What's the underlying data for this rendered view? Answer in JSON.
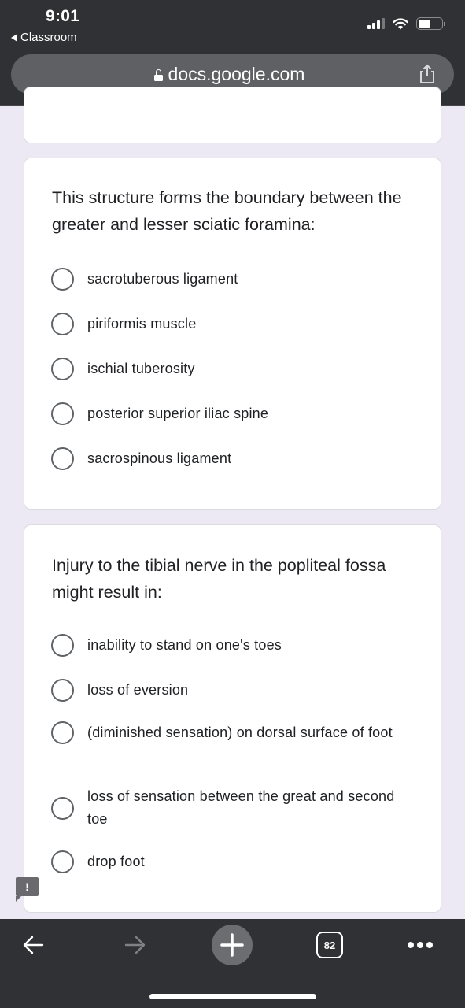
{
  "status_bar": {
    "time": "9:01",
    "back_app_label": "Classroom",
    "icons": [
      "cellular-signal-icon",
      "wifi-icon",
      "battery-icon"
    ]
  },
  "browser": {
    "url": "docs.google.com",
    "secure": true,
    "share_icon": "share-icon",
    "tab_count": "82"
  },
  "form": {
    "questions": [
      {
        "title": "This structure forms the boundary between the greater and lesser sciatic foramina:",
        "options": [
          {
            "label": "sacrotuberous ligament",
            "selected": false
          },
          {
            "label": "piriformis muscle",
            "selected": false
          },
          {
            "label": "ischial tuberosity",
            "selected": false
          },
          {
            "label": "posterior superior iliac spine",
            "selected": false
          },
          {
            "label": "sacrospinous ligament",
            "selected": false
          }
        ]
      },
      {
        "title": "Injury to the tibial nerve in the popliteal fossa might result in:",
        "options": [
          {
            "label": "inability to stand on one's toes",
            "selected": false
          },
          {
            "label": "loss of eversion",
            "selected": false
          },
          {
            "label": "(diminished sensation) on dorsal surface of foot",
            "selected": false
          },
          {
            "label": "loss of sensation between the great and second toe",
            "selected": false
          },
          {
            "label": "drop foot",
            "selected": false
          }
        ]
      }
    ],
    "feedback_badge": "!"
  },
  "toolbar": {
    "items": [
      "back-arrow-icon",
      "forward-arrow-icon",
      "new-tab-plus-icon",
      "tab-switcher",
      "more-menu-icon"
    ]
  },
  "colors": {
    "chrome_bg": "#303134",
    "url_bar_bg": "#5f6064",
    "page_bg": "#ece9f5",
    "card_bg": "#ffffff",
    "text": "#202124",
    "radio_border": "#5f6368"
  }
}
